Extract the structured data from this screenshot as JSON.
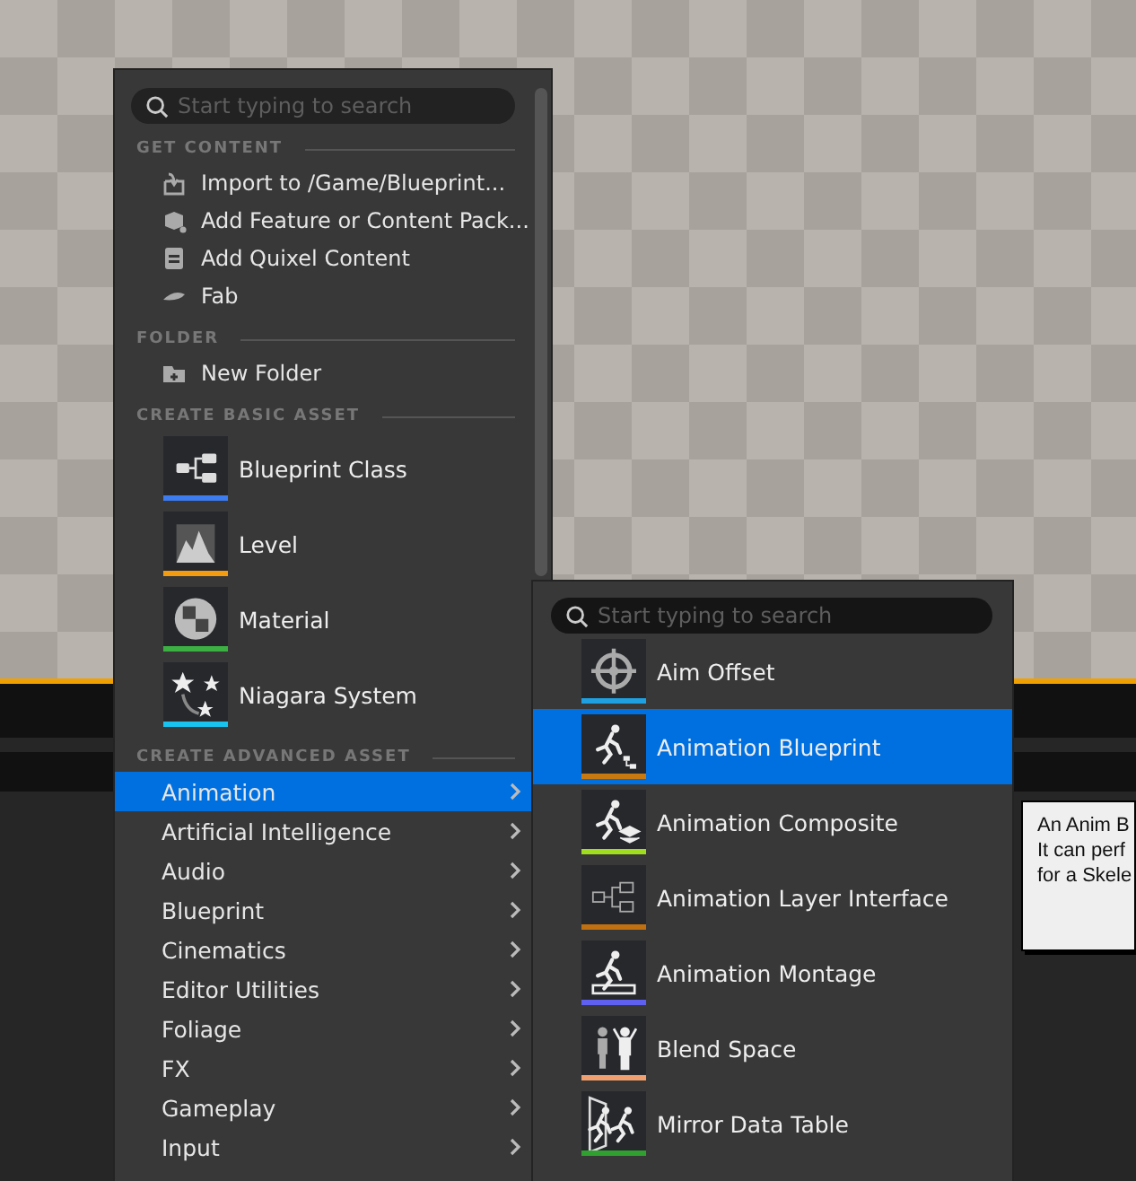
{
  "main_menu": {
    "search": {
      "placeholder": "Start typing to search"
    },
    "sections": [
      {
        "title": "GET CONTENT",
        "kind": "actions",
        "items": [
          {
            "label": "Import to /Game/Blueprint..."
          },
          {
            "label": "Add Feature or Content Pack..."
          },
          {
            "label": "Add Quixel Content"
          },
          {
            "label": "Fab"
          }
        ]
      },
      {
        "title": "FOLDER",
        "kind": "actions",
        "items": [
          {
            "label": "New Folder"
          }
        ]
      },
      {
        "title": "CREATE BASIC ASSET",
        "kind": "assets",
        "items": [
          {
            "label": "Blueprint Class",
            "color": "#3d7bf0"
          },
          {
            "label": "Level",
            "color": "#f39c12"
          },
          {
            "label": "Material",
            "color": "#3cb043"
          },
          {
            "label": "Niagara System",
            "color": "#19c3f0"
          }
        ]
      },
      {
        "title": "CREATE ADVANCED ASSET",
        "kind": "categories",
        "items": [
          {
            "label": "Animation",
            "selected": true
          },
          {
            "label": "Artificial Intelligence",
            "selected": false
          },
          {
            "label": "Audio",
            "selected": false
          },
          {
            "label": "Blueprint",
            "selected": false
          },
          {
            "label": "Cinematics",
            "selected": false
          },
          {
            "label": "Editor Utilities",
            "selected": false
          },
          {
            "label": "Foliage",
            "selected": false
          },
          {
            "label": "FX",
            "selected": false
          },
          {
            "label": "Gameplay",
            "selected": false
          },
          {
            "label": "Input",
            "selected": false
          }
        ]
      }
    ]
  },
  "submenu": {
    "search": {
      "placeholder": "Start typing to search"
    },
    "items": [
      {
        "label": "Aim Offset",
        "color": "#1fa0e0",
        "selected": false
      },
      {
        "label": "Animation Blueprint",
        "color": "#c87a10",
        "selected": true
      },
      {
        "label": "Animation Composite",
        "color": "#a0dc20",
        "selected": false
      },
      {
        "label": "Animation Layer Interface",
        "color": "#c07010",
        "selected": false
      },
      {
        "label": "Animation Montage",
        "color": "#6060f0",
        "selected": false
      },
      {
        "label": "Blend Space",
        "color": "#f0a070",
        "selected": false
      },
      {
        "label": "Mirror Data Table",
        "color": "#30a030",
        "selected": false
      }
    ]
  },
  "tooltip": {
    "lines": [
      "An Anim B",
      "It can perf",
      "for a Skele"
    ]
  }
}
